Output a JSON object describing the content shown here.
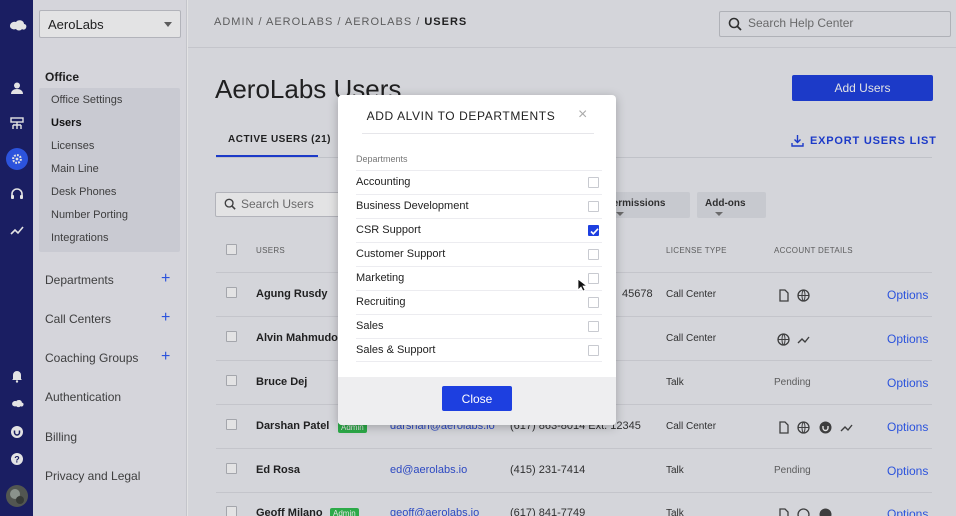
{
  "app": {
    "logo": "aerolabs-logo"
  },
  "rail": {
    "icons": [
      "user-icon",
      "org-chart-icon",
      "settings-icon",
      "headset-icon",
      "analytics-icon",
      "bell-icon",
      "aerolabs-icon",
      "support-badge-icon",
      "help-icon",
      "avatar"
    ],
    "accent": "#2f5cf6",
    "background": "#1b1f6b"
  },
  "sidebar": {
    "org_select": "AeroLabs",
    "office_title": "Office",
    "office_items": [
      "Office Settings",
      "Users",
      "Licenses",
      "Main Line",
      "Desk Phones",
      "Number Porting",
      "Integrations"
    ],
    "active_item": "Users",
    "sections": [
      {
        "label": "Departments",
        "has_add": true
      },
      {
        "label": "Call Centers",
        "has_add": true
      },
      {
        "label": "Coaching Groups",
        "has_add": true
      },
      {
        "label": "Authentication",
        "has_add": false
      },
      {
        "label": "Billing",
        "has_add": false
      },
      {
        "label": "Privacy and Legal",
        "has_add": false
      }
    ]
  },
  "header": {
    "breadcrumb_prefix": "ADMIN / AEROLABS / AEROLABS / ",
    "breadcrumb_current": "USERS",
    "help_placeholder": "Search Help Center"
  },
  "page": {
    "title": "AeroLabs Users",
    "add_users_label": "Add Users",
    "tab_active": "ACTIVE USERS (21)",
    "export_label": "EXPORT USERS LIST",
    "search_placeholder": "Search Users",
    "filters": [
      "Permissions",
      "Add-ons"
    ]
  },
  "table": {
    "headers": {
      "users": "USERS",
      "license": "LICENSE TYPE",
      "account": "ACCOUNT DETAILS"
    },
    "rows": [
      {
        "name": "Agung Rusdy",
        "badge": "",
        "email": "",
        "phone": "45678",
        "license": "Call Center",
        "account_icons": [
          "document-icon",
          "globe-icon"
        ],
        "status": "",
        "options": "Options"
      },
      {
        "name": "Alvin Mahmudo",
        "badge": "",
        "email": "",
        "phone": "",
        "license": "Call Center",
        "account_icons": [
          "globe-icon",
          "trend-icon"
        ],
        "status": "",
        "options": "Options"
      },
      {
        "name": "Bruce Dej",
        "badge": "",
        "email": "",
        "phone": "",
        "license": "Talk",
        "account_icons": [],
        "status": "Pending",
        "options": "Options"
      },
      {
        "name": "Darshan Patel",
        "badge": "Admin",
        "email": "darshan@aerolabs.io",
        "phone": "(617) 863-8014 Ext. 12345",
        "license": "Call Center",
        "account_icons": [
          "document-icon",
          "globe-icon",
          "support-badge-icon",
          "trend-icon"
        ],
        "status": "",
        "options": "Options"
      },
      {
        "name": "Ed Rosa",
        "badge": "",
        "email": "ed@aerolabs.io",
        "phone": "(415) 231-7414",
        "license": "Talk",
        "account_icons": [],
        "status": "Pending",
        "options": "Options"
      },
      {
        "name": "Geoff Milano",
        "badge": "Admin",
        "email": "geoff@aerolabs.io",
        "phone": "(617) 841-7749",
        "license": "Talk",
        "account_icons": [
          "document-icon",
          "globe-icon",
          "support-badge-icon"
        ],
        "status": "",
        "options": "Options"
      }
    ]
  },
  "modal": {
    "title": "ADD ALVIN TO DEPARTMENTS",
    "section_label": "Departments",
    "departments": [
      {
        "label": "Accounting",
        "checked": false
      },
      {
        "label": "Business Development",
        "checked": false
      },
      {
        "label": "CSR Support",
        "checked": true
      },
      {
        "label": "Customer Support",
        "checked": false
      },
      {
        "label": "Marketing",
        "checked": false
      },
      {
        "label": "Recruiting",
        "checked": false
      },
      {
        "label": "Sales",
        "checked": false
      },
      {
        "label": "Sales & Support",
        "checked": false
      }
    ],
    "close_label": "Close"
  },
  "colors": {
    "primary": "#1d3fe0",
    "admin_badge": "#2fbf4e",
    "link": "#2f5cf6"
  }
}
